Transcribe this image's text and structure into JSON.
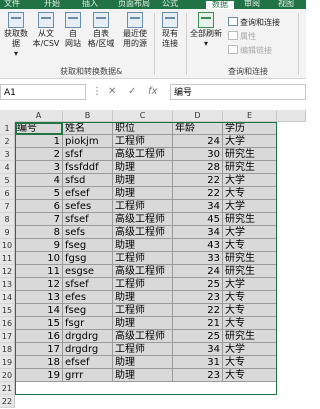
{
  "ribbon_tabs": [
    "文件",
    "开始",
    "插入",
    "页面布局",
    "公式",
    "数据",
    "审阅",
    "视图"
  ],
  "ribbon_active_tab": "数据",
  "get_data_group": {
    "buttons": [
      {
        "label": "获取数据",
        "sub": "▾",
        "icon": "get-data-icon"
      },
      {
        "label": "从文",
        "sub": "本/CSV",
        "icon": "text-csv-icon"
      },
      {
        "label": "自",
        "sub": "网站",
        "icon": "web-icon"
      },
      {
        "label": "自表",
        "sub": "格/区域",
        "icon": "table-range-icon"
      },
      {
        "label": "最近使",
        "sub": "用的源",
        "icon": "recent-sources-icon"
      },
      {
        "label": "现有",
        "sub": "连接",
        "icon": "existing-connections-icon"
      }
    ],
    "label": "获取和转换数据&"
  },
  "query_group": {
    "refresh_label": "全部刷新",
    "refresh_sub": "▾",
    "small": [
      "查询和连接",
      "属性",
      "编辑链接"
    ],
    "label": "查询和连接"
  },
  "name_box": "A1",
  "formula_buttons": [
    "⋮",
    "✕",
    "✓",
    "fx"
  ],
  "formula_value": "编号",
  "columns": [
    "A",
    "B",
    "C",
    "D",
    "E"
  ],
  "rows": [
    [
      "编号",
      "姓名",
      "职位",
      "年龄",
      "学历"
    ],
    [
      "1",
      "piokjm",
      "工程师",
      "24",
      "大学"
    ],
    [
      "2",
      "sfsf",
      "高级工程师",
      "30",
      "研究生"
    ],
    [
      "3",
      "fssfddf",
      "助理",
      "28",
      "研究生"
    ],
    [
      "4",
      "sfsd",
      "助理",
      "22",
      "大学"
    ],
    [
      "5",
      "efsef",
      "助理",
      "22",
      "大专"
    ],
    [
      "6",
      "sefes",
      "工程师",
      "34",
      "大学"
    ],
    [
      "7",
      "sfsef",
      "高级工程师",
      "45",
      "研究生"
    ],
    [
      "8",
      "sefs",
      "高级工程师",
      "34",
      "大学"
    ],
    [
      "9",
      "fseg",
      "助理",
      "43",
      "大专"
    ],
    [
      "10",
      "fgsg",
      "工程师",
      "33",
      "研究生"
    ],
    [
      "11",
      "esgse",
      "高级工程师",
      "24",
      "研究生"
    ],
    [
      "12",
      "sfsef",
      "工程师",
      "25",
      "大学"
    ],
    [
      "13",
      "efes",
      "助理",
      "23",
      "大专"
    ],
    [
      "14",
      "fseg",
      "工程师",
      "22",
      "大专"
    ],
    [
      "15",
      "fsgr",
      "助理",
      "21",
      "大专"
    ],
    [
      "16",
      "drgdrg",
      "高级工程师",
      "25",
      "研究生"
    ],
    [
      "17",
      "drgdrg",
      "工程师",
      "34",
      "大学"
    ],
    [
      "18",
      "efsef",
      "助理",
      "31",
      "大专"
    ],
    [
      "19",
      "grrr",
      "助理",
      "23",
      "大专"
    ]
  ],
  "row_numbers": [
    "1",
    "2",
    "3",
    "4",
    "5",
    "6",
    "7",
    "8",
    "9",
    "10",
    "11",
    "12",
    "13",
    "14",
    "15",
    "16",
    "17",
    "18",
    "19",
    "20",
    "21",
    "22"
  ]
}
